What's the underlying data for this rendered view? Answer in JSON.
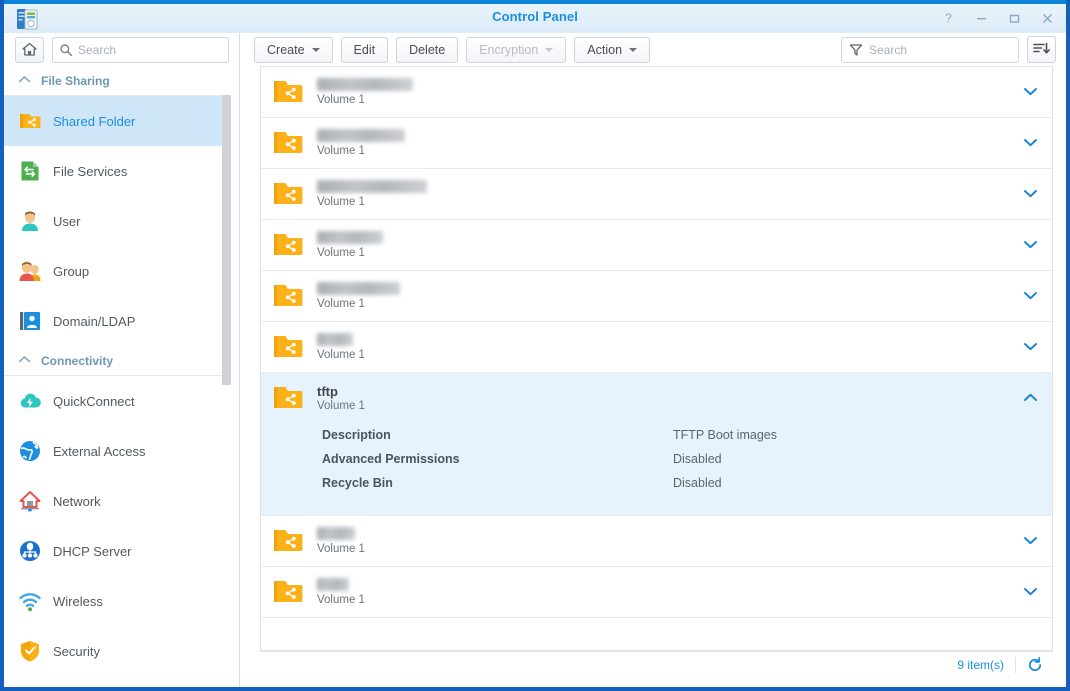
{
  "window": {
    "title": "Control Panel",
    "app_icon": "synology-control-panel-icon",
    "buttons": {
      "help": "?",
      "minimize": "−",
      "maximize": "□",
      "close": "✕"
    }
  },
  "sidebar": {
    "home_icon": "home-icon",
    "search": {
      "placeholder": "Search",
      "value": "",
      "icon": "search-icon"
    },
    "groups": [
      {
        "label": "File Sharing",
        "collapse_icon": "chevron-up-icon",
        "items": [
          {
            "label": "Shared Folder",
            "icon": "shared-folder-icon",
            "active": true
          },
          {
            "label": "File Services",
            "icon": "file-services-icon",
            "active": false
          },
          {
            "label": "User",
            "icon": "user-icon",
            "active": false
          },
          {
            "label": "Group",
            "icon": "group-icon",
            "active": false
          },
          {
            "label": "Domain/LDAP",
            "icon": "domain-ldap-icon",
            "active": false
          }
        ]
      },
      {
        "label": "Connectivity",
        "collapse_icon": "chevron-up-icon",
        "items": [
          {
            "label": "QuickConnect",
            "icon": "quickconnect-icon",
            "active": false
          },
          {
            "label": "External Access",
            "icon": "external-access-icon",
            "active": false
          },
          {
            "label": "Network",
            "icon": "network-icon",
            "active": false
          },
          {
            "label": "DHCP Server",
            "icon": "dhcp-server-icon",
            "active": false
          },
          {
            "label": "Wireless",
            "icon": "wireless-icon",
            "active": false
          },
          {
            "label": "Security",
            "icon": "security-icon",
            "active": false
          }
        ]
      }
    ]
  },
  "toolbar": {
    "create": "Create",
    "edit": "Edit",
    "delete": "Delete",
    "encryption": "Encryption",
    "action": "Action",
    "encryption_disabled": true,
    "search": {
      "placeholder": "Search",
      "value": "",
      "icon": "filter-icon"
    },
    "sort_icon": "sort-descending-icon"
  },
  "list": {
    "volume_label": "Volume 1",
    "rows": [
      {
        "name": "",
        "redacted": true,
        "redacted_width": 96,
        "volume": "Volume 1",
        "expanded": false,
        "chevron": "chevron-down-icon"
      },
      {
        "name": "",
        "redacted": true,
        "redacted_width": 88,
        "volume": "Volume 1",
        "expanded": false,
        "chevron": "chevron-down-icon"
      },
      {
        "name": "",
        "redacted": true,
        "redacted_width": 110,
        "volume": "Volume 1",
        "expanded": false,
        "chevron": "chevron-down-icon"
      },
      {
        "name": "",
        "redacted": true,
        "redacted_width": 66,
        "volume": "Volume 1",
        "expanded": false,
        "chevron": "chevron-down-icon"
      },
      {
        "name": "",
        "redacted": true,
        "redacted_width": 83,
        "volume": "Volume 1",
        "expanded": false,
        "chevron": "chevron-down-icon"
      },
      {
        "name": "",
        "redacted": true,
        "redacted_width": 36,
        "volume": "Volume 1",
        "expanded": false,
        "chevron": "chevron-down-icon"
      },
      {
        "name": "tftp",
        "redacted": false,
        "volume": "Volume 1",
        "expanded": true,
        "chevron": "chevron-up-icon",
        "details": [
          {
            "label": "Description",
            "value": "TFTP Boot images"
          },
          {
            "label": "Advanced Permissions",
            "value": "Disabled"
          },
          {
            "label": "Recycle Bin",
            "value": "Disabled"
          }
        ]
      },
      {
        "name": "",
        "redacted": true,
        "redacted_width": 38,
        "volume": "Volume 1",
        "expanded": false,
        "chevron": "chevron-down-icon"
      },
      {
        "name": "",
        "redacted": true,
        "redacted_width": 32,
        "volume": "Volume 1",
        "expanded": false,
        "chevron": "chevron-down-icon"
      }
    ]
  },
  "status": {
    "count": "9 item(s)",
    "refresh_icon": "refresh-icon"
  },
  "colors": {
    "accent": "#1a8fe0",
    "window_border": "#1560bd",
    "selected_row": "#e6f3fc",
    "selected_sidebar": "#cfe6f9",
    "folder_icon": "#fbb117"
  }
}
